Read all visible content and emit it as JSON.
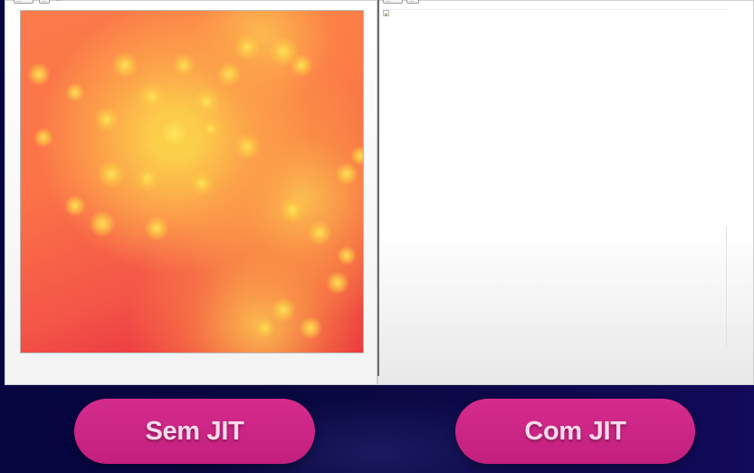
{
  "left_panel": {
    "toolbar": {
      "field_value": "...",
      "button_label": "...",
      "caption": "..."
    },
    "image_alt": "Julia set fractal rendering"
  },
  "right_panel": {
    "toolbar": {
      "field_value": "...",
      "button_label": "..."
    },
    "image_state": "broken-image"
  },
  "labels": {
    "left": "Sem JIT",
    "right": "Com JIT"
  },
  "colors": {
    "background": "#07063a",
    "label_pill": "#c8227f",
    "fractal_outer": "#e51d3d",
    "fractal_inner": "#fce34e"
  },
  "icons": [
    "broken-image-icon"
  ]
}
